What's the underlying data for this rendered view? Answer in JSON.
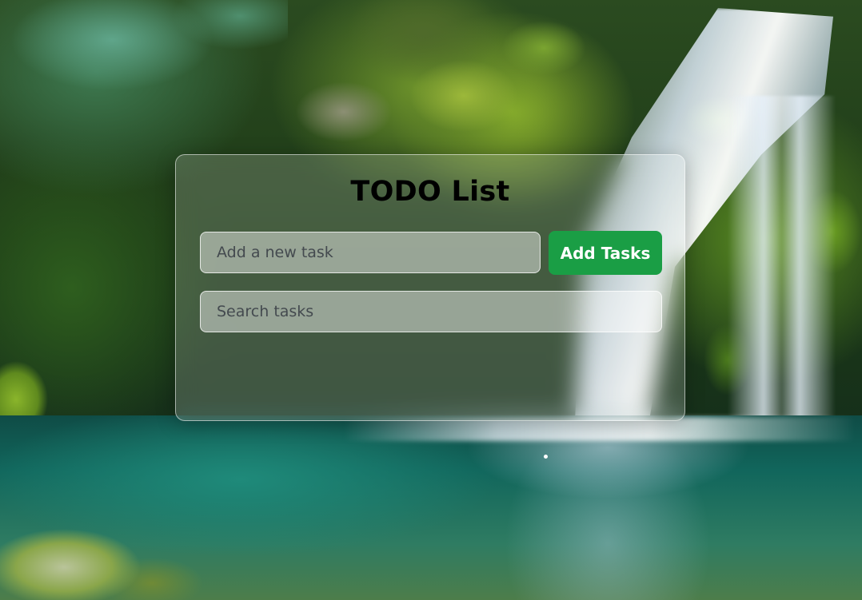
{
  "app": {
    "title": "TODO List"
  },
  "new_task": {
    "placeholder": "Add a new task",
    "value": ""
  },
  "add_button": {
    "label": "Add Tasks",
    "color": "#1a9e45"
  },
  "search": {
    "placeholder": "Search tasks",
    "value": ""
  },
  "tasks": []
}
